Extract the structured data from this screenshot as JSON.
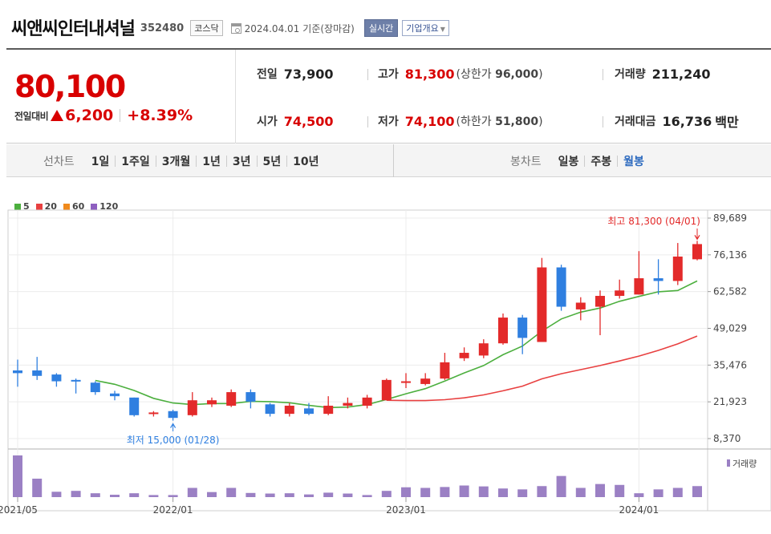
{
  "header": {
    "name": "씨앤씨인터내셔널",
    "code": "352480",
    "market": "코스닥",
    "date": "2024.04.01",
    "basis": "기준(장마감)",
    "realtime_label": "실시간",
    "company_label": "기업개요"
  },
  "quote": {
    "price": "80,100",
    "change_label": "전일대비",
    "change": "6,200",
    "change_pct": "+8.39%",
    "prev_close_label": "전일",
    "prev_close": "73,900",
    "open_label": "시가",
    "open": "74,500",
    "high_label": "고가",
    "high": "81,300",
    "upper_limit_label": "상한가",
    "upper_limit": "96,000",
    "low_label": "저가",
    "low": "74,100",
    "lower_limit_label": "하한가",
    "lower_limit": "51,800",
    "volume_label": "거래량",
    "volume": "211,240",
    "amount_label": "거래대금",
    "amount": "16,736",
    "amount_unit": "백만"
  },
  "tabs": {
    "line_title": "선차트",
    "line_tabs": [
      "1일",
      "1주일",
      "3개월",
      "1년",
      "3년",
      "5년",
      "10년"
    ],
    "candle_title": "봉차트",
    "candle_tabs": [
      "일봉",
      "주봉",
      "월봉"
    ],
    "active_candle": "월봉"
  },
  "chart_data": {
    "type": "candlestick",
    "period": "monthly",
    "legend": [
      {
        "name": "5",
        "color": "#4caf3e"
      },
      {
        "name": "20",
        "color": "#e84040"
      },
      {
        "name": "60",
        "color": "#f08a1c"
      },
      {
        "name": "120",
        "color": "#8e5fc0"
      }
    ],
    "y_ticks": [
      8370,
      21923,
      35476,
      49029,
      62582,
      76136,
      89689
    ],
    "ylim": [
      8370,
      89689
    ],
    "x_labels": [
      {
        "label": "2021/05",
        "index": 0
      },
      {
        "label": "2022/01",
        "index": 8
      },
      {
        "label": "2023/01",
        "index": 20
      },
      {
        "label": "2024/01",
        "index": 32
      }
    ],
    "annotations": {
      "max": {
        "text": "최고 81,300 (04/01)",
        "index": 35,
        "value": 81300
      },
      "min": {
        "text": "최저 15,000 (01/28)",
        "index": 8,
        "value": 15000
      }
    },
    "volume_label": "거래량",
    "candles": [
      {
        "o": 33500,
        "h": 37500,
        "l": 27500,
        "c": 32500
      },
      {
        "o": 33500,
        "h": 38500,
        "l": 30000,
        "c": 31500
      },
      {
        "o": 32000,
        "h": 32500,
        "l": 27500,
        "c": 29500
      },
      {
        "o": 30000,
        "h": 30500,
        "l": 25000,
        "c": 29500
      },
      {
        "o": 29000,
        "h": 29500,
        "l": 24500,
        "c": 25500
      },
      {
        "o": 25000,
        "h": 26000,
        "l": 22500,
        "c": 24000
      },
      {
        "o": 23500,
        "h": 23500,
        "l": 16500,
        "c": 17000
      },
      {
        "o": 17500,
        "h": 18500,
        "l": 16500,
        "c": 18000
      },
      {
        "o": 18500,
        "h": 19000,
        "l": 15000,
        "c": 16000
      },
      {
        "o": 17000,
        "h": 25500,
        "l": 16500,
        "c": 22500
      },
      {
        "o": 21000,
        "h": 23500,
        "l": 20000,
        "c": 22500
      },
      {
        "o": 20500,
        "h": 26500,
        "l": 20000,
        "c": 25500
      },
      {
        "o": 25500,
        "h": 26500,
        "l": 19500,
        "c": 22000
      },
      {
        "o": 21000,
        "h": 21500,
        "l": 16500,
        "c": 17500
      },
      {
        "o": 17500,
        "h": 21500,
        "l": 16500,
        "c": 20500
      },
      {
        "o": 19500,
        "h": 21500,
        "l": 17000,
        "c": 17500
      },
      {
        "o": 17500,
        "h": 24000,
        "l": 17000,
        "c": 20500
      },
      {
        "o": 20500,
        "h": 23500,
        "l": 19500,
        "c": 21500
      },
      {
        "o": 20500,
        "h": 24500,
        "l": 19500,
        "c": 23500
      },
      {
        "o": 22500,
        "h": 30500,
        "l": 22500,
        "c": 30000
      },
      {
        "o": 29500,
        "h": 32500,
        "l": 27000,
        "c": 29500
      },
      {
        "o": 28500,
        "h": 32500,
        "l": 28000,
        "c": 30500
      },
      {
        "o": 30500,
        "h": 40000,
        "l": 30000,
        "c": 36500
      },
      {
        "o": 38000,
        "h": 42000,
        "l": 37000,
        "c": 40000
      },
      {
        "o": 39000,
        "h": 45000,
        "l": 38000,
        "c": 43500
      },
      {
        "o": 43500,
        "h": 54500,
        "l": 43000,
        "c": 53000
      },
      {
        "o": 53000,
        "h": 54000,
        "l": 39500,
        "c": 45500
      },
      {
        "o": 44000,
        "h": 75000,
        "l": 44000,
        "c": 71500
      },
      {
        "o": 71500,
        "h": 72500,
        "l": 55500,
        "c": 57000
      },
      {
        "o": 56000,
        "h": 60500,
        "l": 52000,
        "c": 58500
      },
      {
        "o": 57000,
        "h": 63000,
        "l": 46500,
        "c": 61000
      },
      {
        "o": 61000,
        "h": 67000,
        "l": 60000,
        "c": 63000
      },
      {
        "o": 61500,
        "h": 77500,
        "l": 61500,
        "c": 67500
      },
      {
        "o": 67500,
        "h": 74500,
        "l": 61500,
        "c": 66500
      },
      {
        "o": 66500,
        "h": 80500,
        "l": 65000,
        "c": 75500
      },
      {
        "o": 74500,
        "h": 81300,
        "l": 74100,
        "c": 80100
      }
    ],
    "ma5": [
      null,
      null,
      null,
      null,
      29800,
      28400,
      26100,
      23200,
      21500,
      20900,
      21300,
      21300,
      22100,
      22000,
      21600,
      20600,
      19800,
      20000,
      20900,
      22800,
      24900,
      26800,
      29600,
      32600,
      35300,
      39300,
      42500,
      48000,
      52500,
      55000,
      56500,
      59000,
      60800,
      62500,
      63000,
      66500
    ],
    "ma20": [
      null,
      null,
      null,
      null,
      null,
      null,
      null,
      null,
      null,
      null,
      null,
      null,
      null,
      null,
      null,
      null,
      null,
      null,
      null,
      22500,
      22400,
      22400,
      22700,
      23400,
      24500,
      26000,
      27700,
      30400,
      32300,
      33800,
      35300,
      37000,
      38800,
      40900,
      43300,
      46200
    ],
    "volume": [
      14,
      6.2,
      1.8,
      2.1,
      1.3,
      0.8,
      1.3,
      0.7,
      0.7,
      3.1,
      1.7,
      3.1,
      1.4,
      1.2,
      1.3,
      0.9,
      1.5,
      1.2,
      0.7,
      2.1,
      3.3,
      3.1,
      3.4,
      3.9,
      3.6,
      2.9,
      2.6,
      3.7,
      7.1,
      3.1,
      4.4,
      4.1,
      1.3,
      2.6,
      3.1,
      3.7
    ]
  }
}
